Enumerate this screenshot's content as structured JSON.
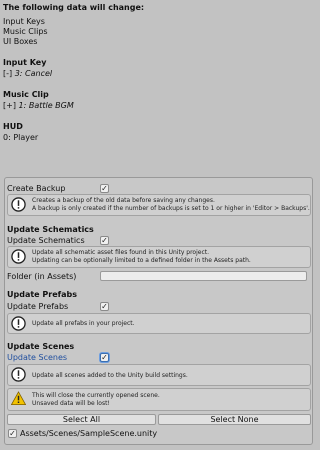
{
  "summary": {
    "heading": "The following data will change:",
    "items": [
      "Input Keys",
      "Music Clips",
      "UI Boxes"
    ]
  },
  "input_key": {
    "heading": "Input Key",
    "prefix": "[-]",
    "value": "3: Cancel"
  },
  "music_clip": {
    "heading": "Music Clip",
    "prefix": "[+]",
    "value": "1: Battle BGM"
  },
  "hud": {
    "heading": "HUD",
    "value": "0: Player"
  },
  "backup": {
    "label": "Create Backup",
    "checked": true,
    "help": [
      "Creates a backup of the old data before saving any changes.",
      "A backup is only created if the number of backups is set to 1 or higher in 'Editor > Backups'."
    ]
  },
  "schematics": {
    "heading": "Update Schematics",
    "label": "Update Schematics",
    "checked": true,
    "help": [
      "Update all schematic asset files found in this Unity project.",
      "Updating can be optionally limited to a defined folder in the Assets path."
    ],
    "folder_label": "Folder (in Assets)",
    "folder_value": ""
  },
  "prefabs": {
    "heading": "Update Prefabs",
    "label": "Update Prefabs",
    "checked": true,
    "help": [
      "Update all prefabs in your project."
    ]
  },
  "scenes": {
    "heading": "Update Scenes",
    "label": "Update Scenes",
    "checked": true,
    "help": [
      "Update all scenes added to the Unity build settings."
    ],
    "warning": [
      "This will close the currently opened scene.",
      "Unsaved data will be lost!"
    ]
  },
  "buttons": {
    "select_all": "Select All",
    "select_none": "Select None"
  },
  "scene_item": {
    "label": "Assets/Scenes/SampleScene.unity",
    "checked": true
  },
  "colors": {
    "background": "#c2c2c2",
    "accent_blue": "#1f4e9e",
    "warning_yellow": "#f2c200"
  },
  "icons": {
    "info": "info-icon",
    "warning": "warning-icon",
    "check": "check-icon"
  }
}
